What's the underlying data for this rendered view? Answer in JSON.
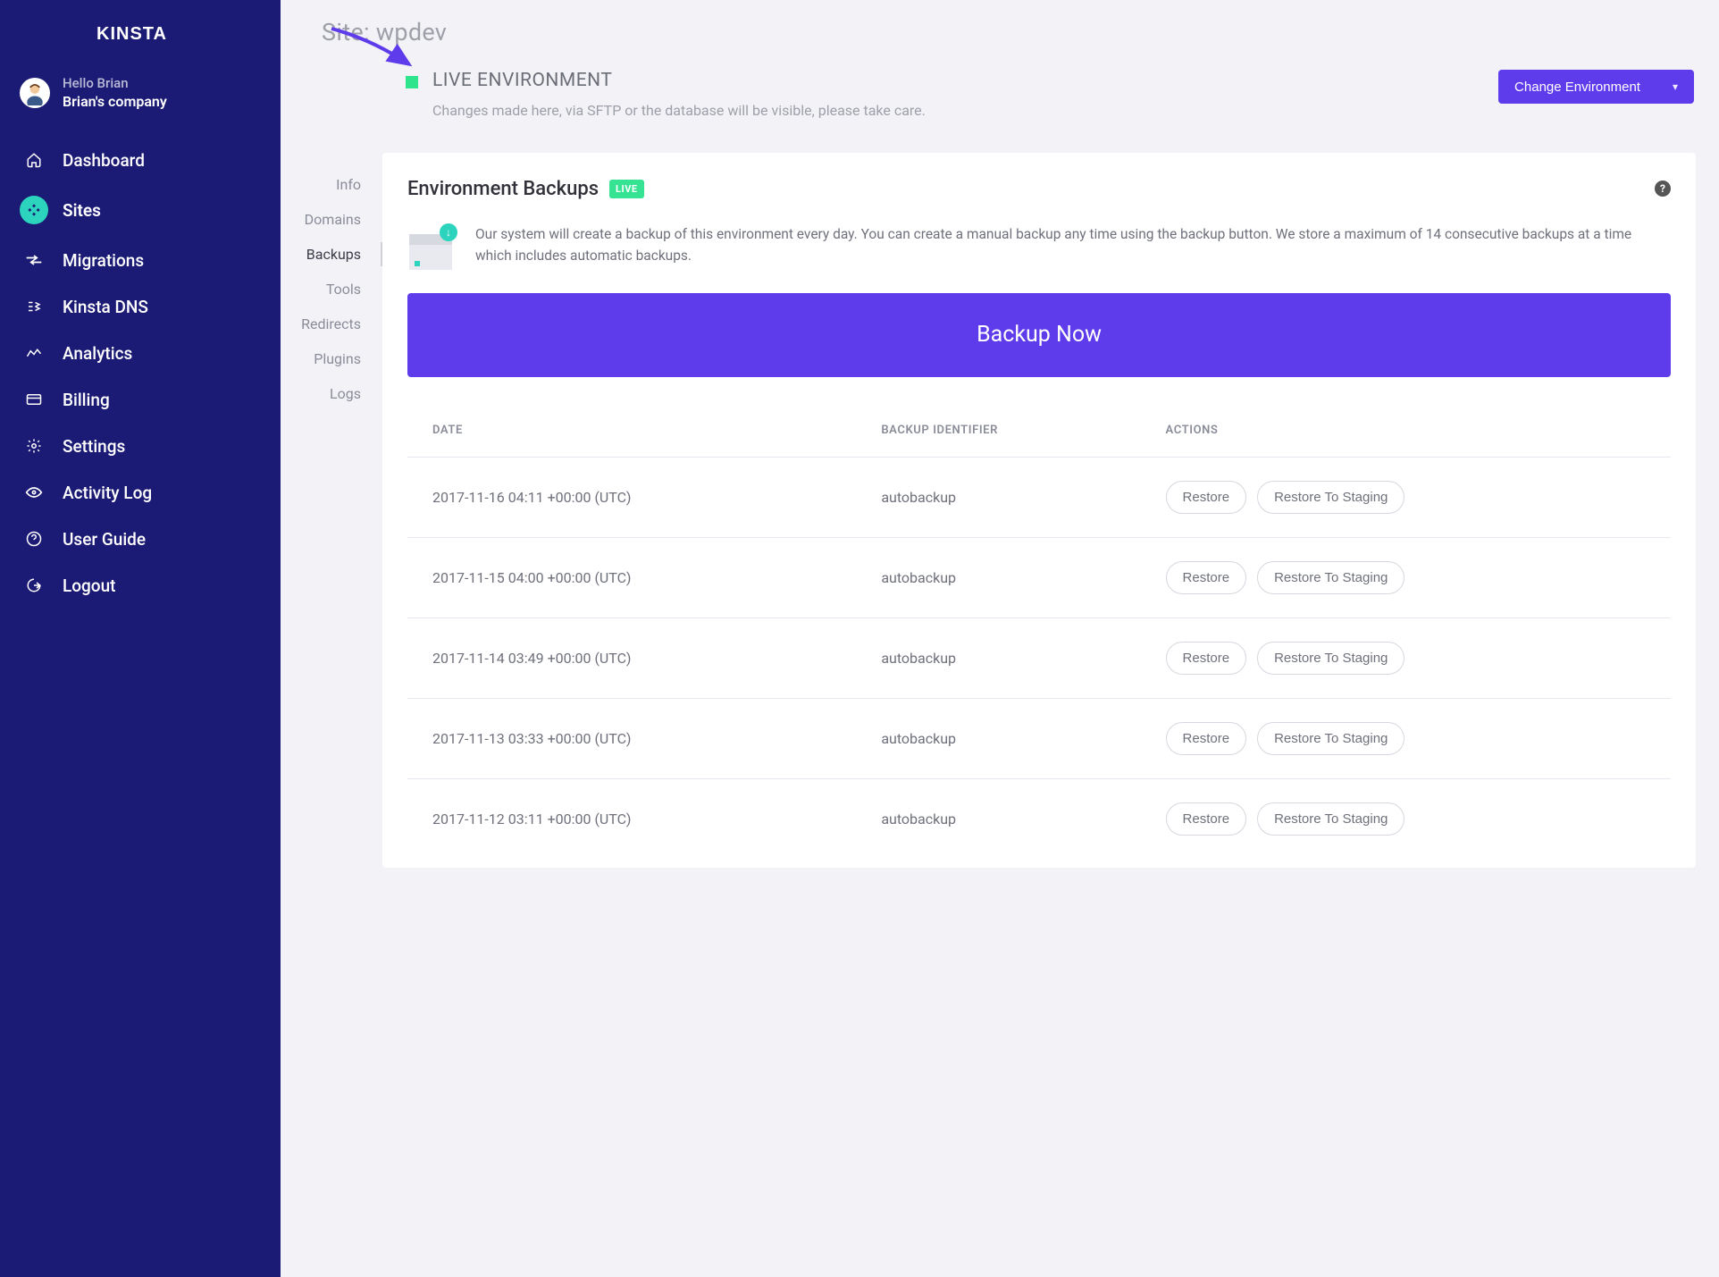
{
  "brand": "KINSTA",
  "account": {
    "greeting": "Hello Brian",
    "company": "Brian's company"
  },
  "nav": {
    "dashboard": "Dashboard",
    "sites": "Sites",
    "migrations": "Migrations",
    "dns": "Kinsta DNS",
    "analytics": "Analytics",
    "billing": "Billing",
    "settings": "Settings",
    "activity": "Activity Log",
    "guide": "User Guide",
    "logout": "Logout"
  },
  "page": {
    "title": "Site: wpdev"
  },
  "env": {
    "title": "LIVE ENVIRONMENT",
    "desc": "Changes made here, via SFTP or the database will be visible, please take care.",
    "change_button": "Change Environment"
  },
  "subnav": {
    "info": "Info",
    "domains": "Domains",
    "backups": "Backups",
    "tools": "Tools",
    "redirects": "Redirects",
    "plugins": "Plugins",
    "logs": "Logs"
  },
  "panel": {
    "title": "Environment Backups",
    "badge": "LIVE",
    "description": "Our system will create a backup of this environment every day. You can create a manual backup any time using the backup button. We store a maximum of 14 consecutive backups at a time which includes automatic backups.",
    "backup_now": "Backup Now",
    "columns": {
      "date": "DATE",
      "identifier": "BACKUP IDENTIFIER",
      "actions": "ACTIONS"
    },
    "restore_label": "Restore",
    "restore_staging_label": "Restore To Staging"
  },
  "backups": [
    {
      "date": "2017-11-16 04:11 +00:00 (UTC)",
      "id": "autobackup"
    },
    {
      "date": "2017-11-15 04:00 +00:00 (UTC)",
      "id": "autobackup"
    },
    {
      "date": "2017-11-14 03:49 +00:00 (UTC)",
      "id": "autobackup"
    },
    {
      "date": "2017-11-13 03:33 +00:00 (UTC)",
      "id": "autobackup"
    },
    {
      "date": "2017-11-12 03:11 +00:00 (UTC)",
      "id": "autobackup"
    }
  ]
}
